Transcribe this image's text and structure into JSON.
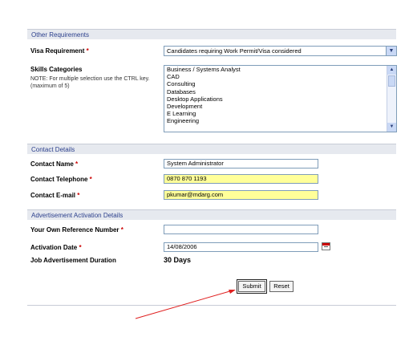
{
  "sections": {
    "other_requirements": "Other Requirements",
    "contact_details": "Contact Details",
    "advertisement_activation": "Advertisement Activation Details"
  },
  "fields": {
    "visa_label": "Visa Requirement",
    "visa_value": "Candidates requiring Work Permit/Visa considered",
    "skills_label": "Skills Categories",
    "skills_note": "NOTE: For multiple selection use the CTRL key. (maximum of 5)",
    "skills_options": [
      "Business / Systems Analyst",
      "CAD",
      "Consulting",
      "Databases",
      "Desktop Applications",
      "Development",
      "E Learning",
      "Engineering"
    ],
    "contact_name_label": "Contact Name",
    "contact_name_value": "System Administrator",
    "contact_phone_label": "Contact Telephone",
    "contact_phone_value": "0870 870 1193",
    "contact_email_label": "Contact E-mail",
    "contact_email_value": "pkumar@mdarg.com",
    "ref_label": "Your Own Reference Number",
    "ref_value": "",
    "activation_label": "Activation Date",
    "activation_value": "14/08/2006",
    "duration_label": "Job Advertisement Duration",
    "duration_value": "30 Days"
  },
  "required_mark": "*",
  "buttons": {
    "submit": "Submit",
    "reset": "Reset"
  },
  "colors": {
    "section_bg": "#e6e9ef",
    "section_text": "#2b3f8c",
    "highlight": "#ffff99",
    "required": "#cc0000",
    "arrow": "#e02020"
  }
}
